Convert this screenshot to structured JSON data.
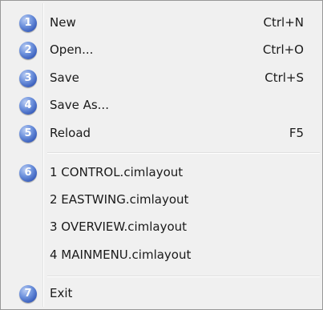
{
  "menu": {
    "items": [
      {
        "number": "1",
        "label": "New",
        "shortcut": "Ctrl+N"
      },
      {
        "number": "2",
        "label": "Open...",
        "shortcut": "Ctrl+O"
      },
      {
        "number": "3",
        "label": "Save",
        "shortcut": "Ctrl+S"
      },
      {
        "number": "4",
        "label": "Save As...",
        "shortcut": ""
      },
      {
        "number": "5",
        "label": "Reload",
        "shortcut": "F5"
      }
    ],
    "recent": {
      "number": "6",
      "files": [
        "1 CONTROL.cimlayout",
        "2 EASTWING.cimlayout",
        "3 OVERVIEW.cimlayout",
        "4 MAINMENU.cimlayout"
      ]
    },
    "exit": {
      "number": "7",
      "label": "Exit"
    }
  },
  "colors": {
    "badge": "#3f64c4",
    "menu_background": "#f0f0f0",
    "text": "#1a1a1a"
  }
}
